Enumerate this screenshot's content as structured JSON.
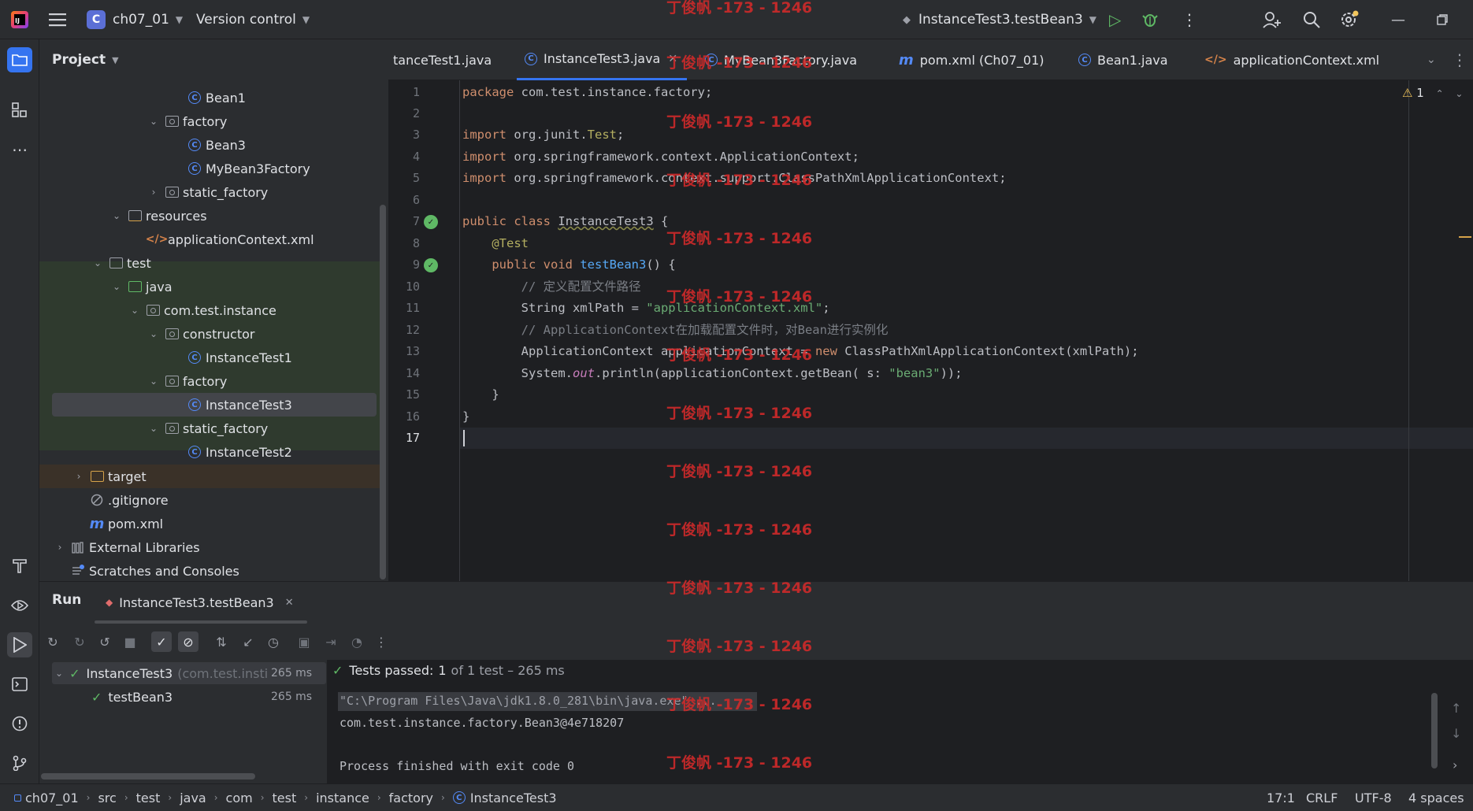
{
  "titlebar": {
    "project_initial": "C",
    "project_name": "ch07_01",
    "vcs": "Version control",
    "run_config": "InstanceTest3.testBean3"
  },
  "project_panel": {
    "title": "Project",
    "tree": [
      {
        "label": "Bean1",
        "type": "class"
      },
      {
        "label": "factory",
        "type": "package"
      },
      {
        "label": "Bean3",
        "type": "class"
      },
      {
        "label": "MyBean3Factory",
        "type": "class"
      },
      {
        "label": "static_factory",
        "type": "package"
      },
      {
        "label": "resources",
        "type": "resources"
      },
      {
        "label": "applicationContext.xml",
        "type": "xml"
      },
      {
        "label": "test",
        "type": "folder"
      },
      {
        "label": "java",
        "type": "folder-green"
      },
      {
        "label": "com.test.instance",
        "type": "package"
      },
      {
        "label": "constructor",
        "type": "package"
      },
      {
        "label": "InstanceTest1",
        "type": "class"
      },
      {
        "label": "factory",
        "type": "package"
      },
      {
        "label": "InstanceTest3",
        "type": "class"
      },
      {
        "label": "static_factory",
        "type": "package"
      },
      {
        "label": "InstanceTest2",
        "type": "class"
      },
      {
        "label": "target",
        "type": "folder-orange"
      },
      {
        "label": ".gitignore",
        "type": "ignore"
      },
      {
        "label": "pom.xml",
        "type": "maven"
      },
      {
        "label": "External Libraries",
        "type": "library"
      },
      {
        "label": "Scratches and Consoles",
        "type": "scratch"
      }
    ]
  },
  "tabs": [
    {
      "label": "tanceTest1.java"
    },
    {
      "label": "InstanceTest3.java"
    },
    {
      "label": "MyBean3Factory.java"
    },
    {
      "label": "pom.xml (Ch07_01)"
    },
    {
      "label": "Bean1.java"
    },
    {
      "label": "applicationContext.xml"
    }
  ],
  "editor": {
    "line_numbers": [
      "1",
      "2",
      "3",
      "4",
      "5",
      "6",
      "7",
      "8",
      "9",
      "10",
      "11",
      "12",
      "13",
      "14",
      "15",
      "16",
      "17"
    ],
    "lines": [
      "package com.test.instance.factory;",
      "",
      "import org.junit.Test;",
      "import org.springframework.context.ApplicationContext;",
      "import org.springframework.context.support.ClassPathXmlApplicationContext;",
      "",
      "public class InstanceTest3 {",
      "    @Test",
      "    public void testBean3() {",
      "        // 定义配置文件路径",
      "        String xmlPath = \"applicationContext.xml\";",
      "        // ApplicationContext在加载配置文件时，对Bean进行实例化",
      "        ApplicationContext applicationContext = new ClassPathXmlApplicationContext(xmlPath);",
      "        System.out.println(applicationContext.getBean( s: \"bean3\"));",
      "    }",
      "}",
      ""
    ],
    "warning_count": "1",
    "cursor": "17:1"
  },
  "watermark": "丁俊帆 -173 - 1246",
  "run_panel": {
    "label": "Run",
    "tab": "InstanceTest3.testBean3",
    "tests": [
      {
        "name": "InstanceTest3",
        "package": "(com.test.insti",
        "time": "265 ms"
      },
      {
        "name": "testBean3",
        "time": "265 ms"
      }
    ],
    "status_prefix": "Tests passed:",
    "status_count": "1",
    "status_suffix": "of 1 test – 265 ms",
    "console": [
      "\"C:\\Program Files\\Java\\jdk1.8.0_281\\bin\\java.exe\" ...",
      "com.test.instance.factory.Bean3@4e718207",
      "",
      "Process finished with exit code 0"
    ]
  },
  "statusbar": {
    "breadcrumbs": [
      "ch07_01",
      "src",
      "test",
      "java",
      "com",
      "test",
      "instance",
      "factory",
      "InstanceTest3"
    ],
    "position": "17:1",
    "line_sep": "CRLF",
    "encoding": "UTF-8",
    "indent": "4 spaces"
  },
  "colors": {
    "accent": "#3574f0",
    "pass": "#5fb865",
    "watermark": "#d32a2a"
  }
}
